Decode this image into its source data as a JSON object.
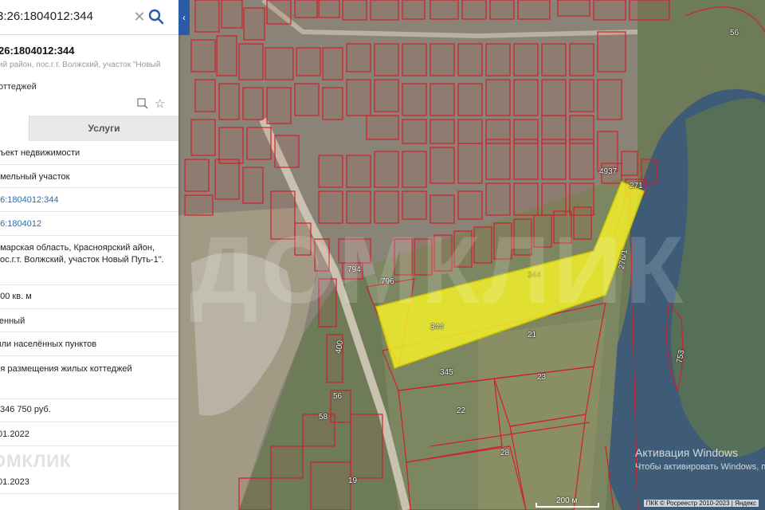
{
  "search": {
    "value": "3:26:1804012:344",
    "clear_icon": "close-icon",
    "search_icon": "search-icon"
  },
  "object": {
    "title": "26:1804012:344",
    "address": "ий район, пос.г.т. Волжский, участок \"Новый",
    "type": "оттеджей"
  },
  "tabs": {
    "services": "Услуги"
  },
  "details": {
    "kind": "бъект недвижимости",
    "category": "емельный участок",
    "cad_number": "26:1804012:344",
    "cad_quarter": "26:1804012",
    "address_full": "амарская область, Красноярский айон, пос.г.т. Волжский, участок Новый Путь-1\".",
    "area": "000 кв. м",
    "status": "тенный",
    "land_category": "мли населённых пунктов",
    "permitted_use": "ля размещения жилых коттеджей",
    "cost": "346 750 руб.",
    "cost_date": ".01.2022",
    "date_2": ".01.2023"
  },
  "watermark_left": "ОМКЛИК",
  "map": {
    "highlight_labels": [
      "344",
      "344"
    ],
    "plot_labels": [
      "21",
      "23",
      "22",
      "28",
      "345",
      "796",
      "794",
      "276/1",
      "753",
      "56",
      "271",
      "4937",
      "19",
      "56",
      "58",
      "400"
    ],
    "watermark": "ДОМКЛИК",
    "scale_label": "200 м",
    "copyright": "ПКК © Росреестр 2010-2023 | Яндекс",
    "colors": {
      "boundary": "#d0202a",
      "highlight": "#f2ef2a",
      "water": "#3e5c78",
      "land": "#6e7b58"
    }
  },
  "windows": {
    "line1": "Активация Windows",
    "line2": "Чтобы активировать Windows, перейдите в раздел \"Параметры\"."
  }
}
